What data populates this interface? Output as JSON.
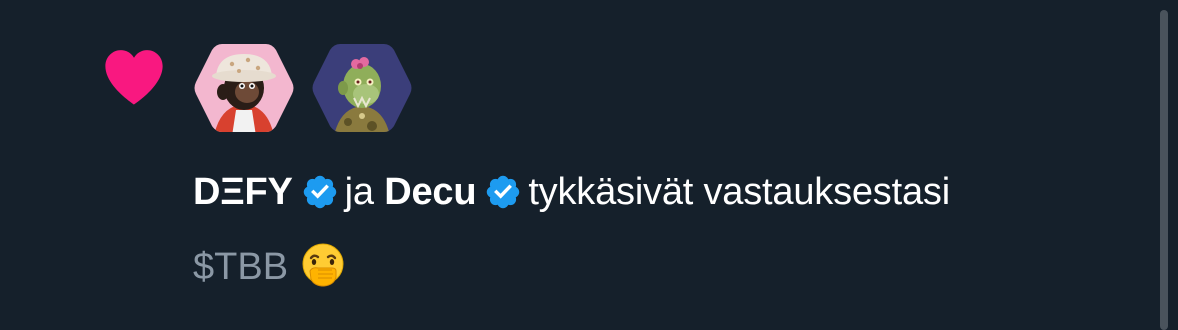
{
  "notification": {
    "type_icon": "heart-icon",
    "avatars": [
      {
        "name": "DEFY",
        "image": "ape-avatar-bucket-hat"
      },
      {
        "name": "Decu",
        "image": "zombie-ape-avatar"
      }
    ],
    "user1_name": "DΞFY",
    "user1_badge": "verified-badge-icon",
    "connector": "ja",
    "user2_name": "Decu",
    "user2_badge": "verified-badge-icon",
    "action_text": "tykkäsivät vastauksestasi",
    "tweet_text": "$TBB",
    "tweet_emoji": "face-with-hand-over-mouth-emoji"
  },
  "colors": {
    "background": "#15202b",
    "heart": "#f91880",
    "verified": "#1d9bf0",
    "primary_text": "#ffffff",
    "secondary_text": "#8b98a5"
  }
}
